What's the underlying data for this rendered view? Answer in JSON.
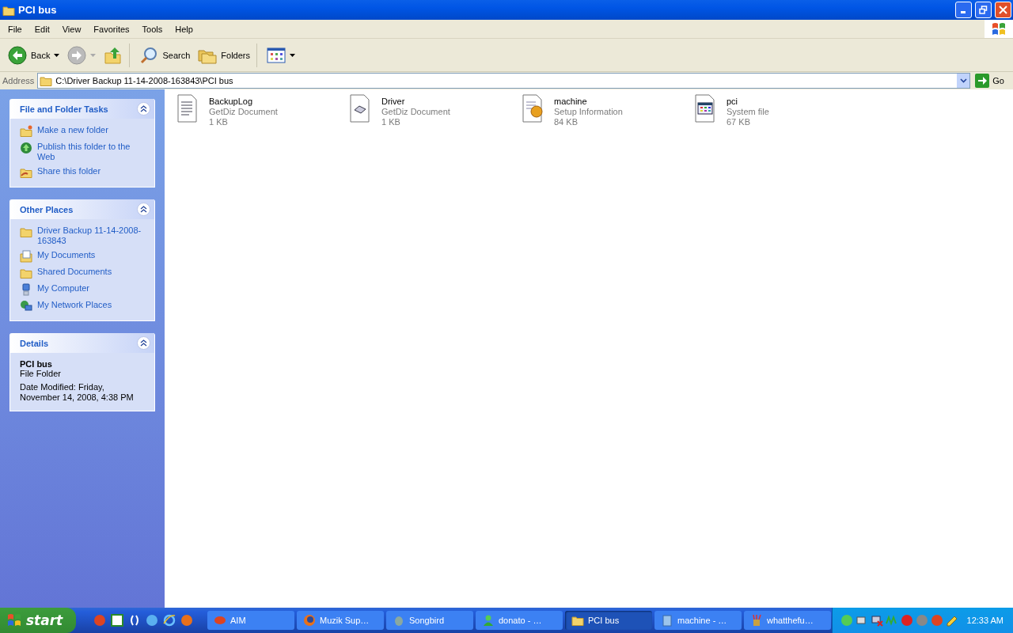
{
  "window": {
    "title": "PCI bus"
  },
  "menu": [
    "File",
    "Edit",
    "View",
    "Favorites",
    "Tools",
    "Help"
  ],
  "toolbar": [
    {
      "kind": "back",
      "label": "Back"
    },
    {
      "kind": "forward",
      "disabled": true
    },
    {
      "kind": "up"
    },
    {
      "kind": "search",
      "label": "Search"
    },
    {
      "kind": "folders",
      "label": "Folders"
    },
    {
      "kind": "views"
    }
  ],
  "address": {
    "label": "Address",
    "path": "C:\\Driver Backup 11-14-2008-163843\\PCI bus",
    "go": "Go"
  },
  "sidebar": [
    {
      "kind": "links",
      "title": "File and Folder Tasks",
      "items": [
        {
          "kind": "newfolder",
          "label": "Make a new folder"
        },
        {
          "kind": "publish",
          "label": "Publish this folder to the Web"
        },
        {
          "kind": "share",
          "label": "Share this folder"
        }
      ]
    },
    {
      "kind": "links",
      "title": "Other Places",
      "items": [
        {
          "kind": "folder",
          "label": "Driver Backup 11-14-2008-163843"
        },
        {
          "kind": "documents",
          "label": "My Documents"
        },
        {
          "kind": "folder",
          "label": "Shared Documents"
        },
        {
          "kind": "computer",
          "label": "My Computer"
        },
        {
          "kind": "network",
          "label": "My Network Places"
        }
      ]
    },
    {
      "kind": "details",
      "title": "Details",
      "name": "PCI bus",
      "type": "File Folder",
      "modified": "Date Modified: Friday, November 14, 2008, 4:38 PM"
    }
  ],
  "files": [
    {
      "kind": "text",
      "name": "BackupLog",
      "type": "GetDiz Document",
      "size": "1 KB"
    },
    {
      "kind": "generic",
      "name": "Driver",
      "type": "GetDiz Document",
      "size": "1 KB"
    },
    {
      "kind": "setup",
      "name": "machine",
      "type": "Setup Information",
      "size": "84 KB"
    },
    {
      "kind": "system",
      "name": "pci",
      "type": "System file",
      "size": "67 KB"
    }
  ],
  "taskbar": {
    "start": "start",
    "tasks": [
      {
        "kind": "aim",
        "label": "AIM",
        "selected": false
      },
      {
        "kind": "firefox",
        "label": "Muzik Sup…",
        "selected": false
      },
      {
        "kind": "songbird",
        "label": "Songbird",
        "selected": false
      },
      {
        "kind": "buddy",
        "label": "donato - …",
        "selected": false
      },
      {
        "kind": "folder",
        "label": "PCI bus",
        "selected": true
      },
      {
        "kind": "notepad",
        "label": "machine - …",
        "selected": false
      },
      {
        "kind": "paint",
        "label": "whatthefu…",
        "selected": false
      }
    ],
    "clock": "12:33 AM"
  }
}
